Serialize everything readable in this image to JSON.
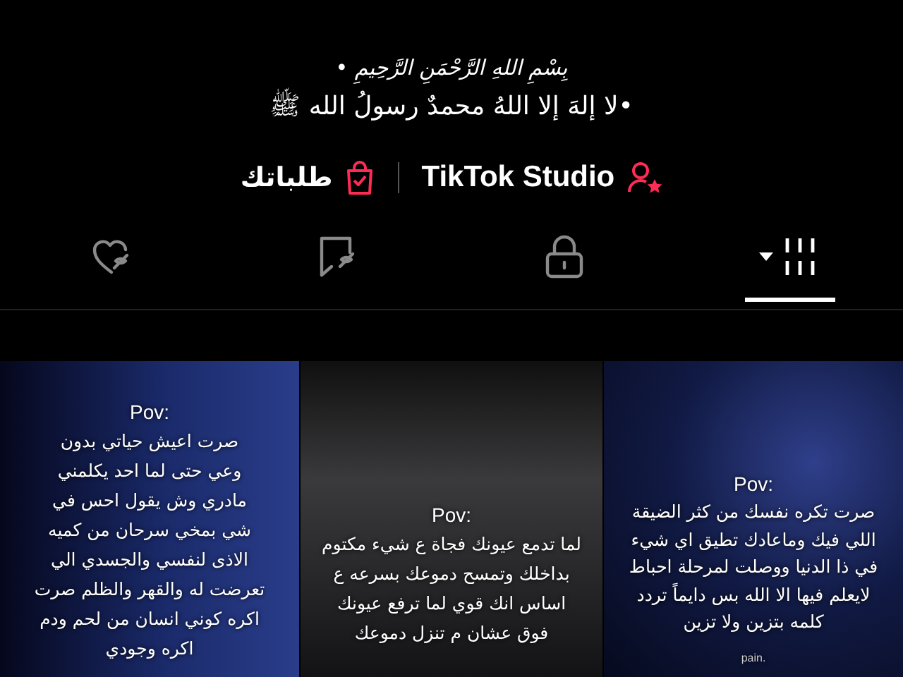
{
  "bio": [
    {
      "kind": "basmala",
      "text": "بِسْمِ اللهِ الرَّحْمَنِ الرَّحِيمِ •"
    },
    {
      "kind": "line",
      "text": "•لا إلهَ إلا اللهُ محمدٌ رسولُ الله ﷺ"
    }
  ],
  "links": [
    {
      "kind": "studio",
      "label": "TikTok Studio"
    },
    {
      "kind": "orders",
      "label": "طلباتك"
    }
  ],
  "tabs": [
    {
      "kind": "videos",
      "selected": true
    },
    {
      "kind": "private",
      "selected": false
    },
    {
      "kind": "saved",
      "selected": false
    },
    {
      "kind": "liked",
      "selected": false
    }
  ],
  "videos": [
    {
      "kind": "street",
      "title": "Pov:",
      "lines": [
        "صرت تكره نفسك من كثر الضيقة",
        "اللي فيك وماعادك تطيق اي شيء",
        "في ذا الدنيا ووصلت لمرحلة احباط",
        "لايعلم فيها الا الله بس دايماً تردد",
        "كلمه بتزين ولا تزين"
      ],
      "caption": "pain."
    },
    {
      "kind": "room",
      "title": "Pov:",
      "lines": [
        "لما تدمع عيونك فجاة ع شيء مكتوم",
        "بداخلك وتمسح دموعك بسرعه ع",
        "اساس انك قوي لما ترفع عيونك",
        "فوق عشان م تنزل دموعك"
      ]
    },
    {
      "kind": "window",
      "title": "Pov:",
      "lines": [
        "صرت اعيش حياتي بدون",
        "وعي حتى لما احد يكلمني",
        "مادري وش يقول احس في",
        "شي بمخي سرحان من كميه",
        "الاذى لنفسي والجسدي الي",
        "تعرضت له والقهر والظلم صرت",
        "اكره كوني انسان من لحم ودم",
        "اكره وجودي"
      ]
    }
  ]
}
